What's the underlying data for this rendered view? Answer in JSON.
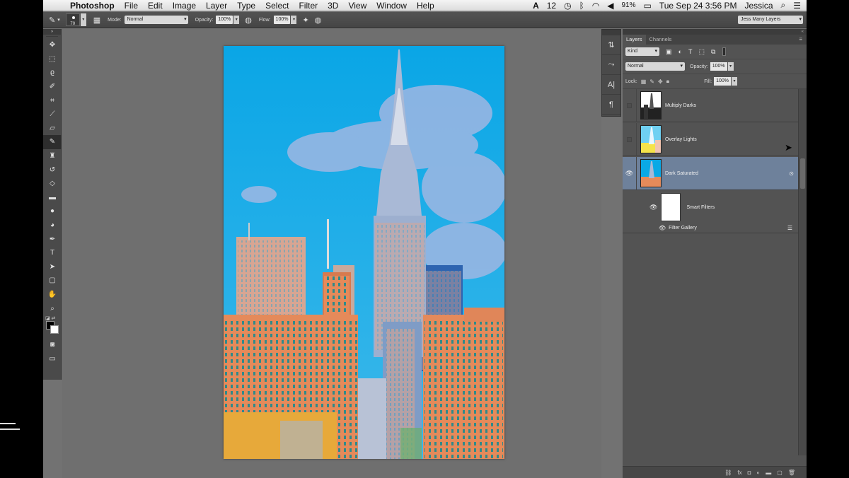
{
  "menubar": {
    "app_name": "Photoshop",
    "menus": [
      "File",
      "Edit",
      "Image",
      "Layer",
      "Type",
      "Select",
      "Filter",
      "3D",
      "View",
      "Window",
      "Help"
    ],
    "adobe_badge": "12",
    "battery": "91%",
    "datetime": "Tue Sep 24  3:56 PM",
    "user": "Jessica"
  },
  "options_bar": {
    "brush_size": "70",
    "mode_label": "Mode:",
    "mode_value": "Normal",
    "opacity_label": "Opacity:",
    "opacity_value": "100%",
    "flow_label": "Flow:",
    "flow_value": "100%",
    "workspace": "Jess Many Layers"
  },
  "toolbar": {
    "tools": [
      "move-tool-icon",
      "marquee-tool-icon",
      "lasso-tool-icon",
      "quick-select-tool-icon",
      "crop-tool-icon",
      "eyedropper-tool-icon",
      "healing-brush-tool-icon",
      "brush-tool-icon",
      "clone-stamp-tool-icon",
      "history-brush-tool-icon",
      "eraser-tool-icon",
      "gradient-tool-icon",
      "blur-tool-icon",
      "dodge-tool-icon",
      "pen-tool-icon",
      "type-tool-icon",
      "path-select-tool-icon",
      "shape-tool-icon",
      "hand-tool-icon",
      "zoom-tool-icon"
    ],
    "active_tool": "brush-tool-icon"
  },
  "layers_panel": {
    "tabs": [
      "Layers",
      "Channels"
    ],
    "active_tab": "Layers",
    "filter_kind": "Kind",
    "blend_mode": "Normal",
    "opacity_label": "Opacity:",
    "opacity_value": "100%",
    "lock_label": "Lock:",
    "fill_label": "Fill:",
    "fill_value": "100%",
    "layers": [
      {
        "name": "Multiply Darks",
        "visible": false,
        "selected": false
      },
      {
        "name": "Overlay Lights",
        "visible": false,
        "selected": false
      },
      {
        "name": "Dark Saturated",
        "visible": true,
        "selected": true
      }
    ],
    "smart_filters_label": "Smart Filters",
    "filter_gallery_label": "Filter Gallery"
  },
  "colors": {
    "sky": "#0aa9e6",
    "selected_layer": "#6e819b",
    "brick": "#e58a5a"
  }
}
